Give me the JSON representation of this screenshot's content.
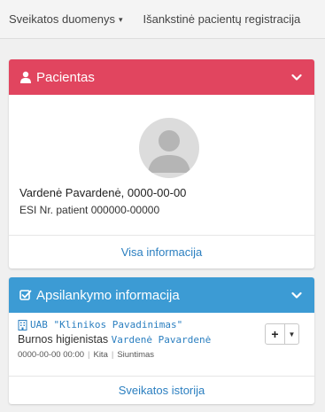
{
  "topnav": {
    "items": [
      {
        "label": "Sveikatos duomenys",
        "has_dropdown": true
      },
      {
        "label": "Išankstinė pacientų registracija",
        "has_dropdown": false
      }
    ]
  },
  "patient_panel": {
    "title": "Pacientas",
    "color": "#e1455f",
    "icon": "user-icon",
    "name_bold": "Vardenė Pavardenė,",
    "birth_date": " 0000-00-00",
    "esi_label": "ESI Nr. patient 000000-00000",
    "footer_link": "Visa informacija"
  },
  "visit_panel": {
    "title": "Apsilankymo informacija",
    "color": "#3c9bd4",
    "icon": "checkbox-edit-icon",
    "clinic_name": "UAB \"Klinikos Pavadinimas\"",
    "role": "Burnos higienistas ",
    "doctor_name": "Vardenė Pavardenė",
    "datetime": "0000-00-00 00:00",
    "type": "Kita",
    "referral": "Siuntimas",
    "add_label": "+",
    "footer_link": "Sveikatos istorija"
  }
}
